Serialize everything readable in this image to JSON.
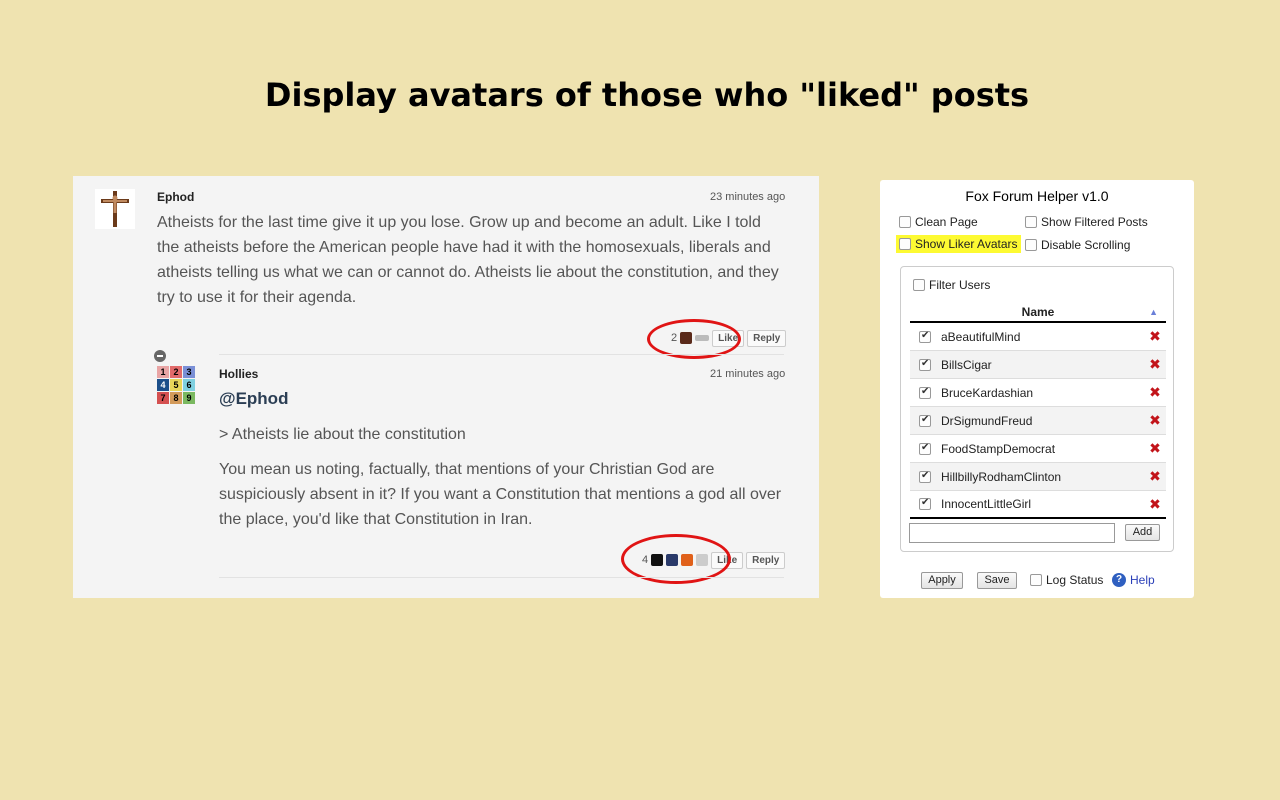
{
  "headline": "Display avatars of those who \"liked\" posts",
  "comments": {
    "post1": {
      "username": "Ephod",
      "time": "23 minutes ago",
      "body": "Atheists for the last time give it up you lose. Grow up and become an adult. Like I told the atheists before the American people have had it with the homosexuals, liberals and atheists telling us what we can or cannot do. Atheists lie about the constitution, and they try to use it for their agenda.",
      "like_count": "2",
      "like_label": "Like",
      "reply_label": "Reply"
    },
    "post2": {
      "username": "Hollies",
      "time": "21 minutes ago",
      "mention": "@Ephod",
      "quote": "> Atheists lie about the constitution",
      "body": "You mean us noting, factually, that mentions of your Christian God are suspiciously absent in it? If you want a Constitution that mentions a god all over the place, you'd like that Constitution in Iran.",
      "like_count": "4",
      "like_label": "Like",
      "reply_label": "Reply",
      "grid_numbers": [
        "1",
        "2",
        "3",
        "4",
        "5",
        "6",
        "7",
        "8",
        "9"
      ]
    }
  },
  "extension": {
    "title": "Fox Forum Helper v1.0",
    "options": {
      "clean_page": "Clean Page",
      "show_filtered": "Show Filtered Posts",
      "show_liker_avatars": "Show Liker Avatars",
      "disable_scrolling": "Disable Scrolling"
    },
    "filter_users_label": "Filter Users",
    "column_name": "Name",
    "users": [
      "aBeautifulMind",
      "BillsCigar",
      "BruceKardashian",
      "DrSigmundFreud",
      "FoodStampDemocrat",
      "HillbillyRodhamClinton",
      "InnocentLittleGirl"
    ],
    "add_label": "Add",
    "add_placeholder": "",
    "apply_label": "Apply",
    "save_label": "Save",
    "log_status_label": "Log Status",
    "help_label": "Help",
    "help_icon": "?"
  },
  "colors": {
    "background": "#efe3b0",
    "highlight": "#fdfa32",
    "ring": "#e01414",
    "delete": "#c2141a"
  }
}
